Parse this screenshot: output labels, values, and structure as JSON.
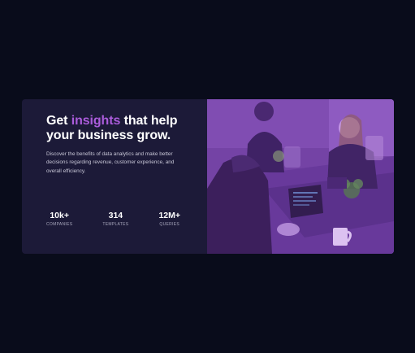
{
  "hero": {
    "headline_pre": "Get ",
    "headline_accent": "insights",
    "headline_post": " that help your business grow.",
    "description": "Discover the benefits of data analytics and make better decisions regarding revenue, customer experience, and overall efficiency."
  },
  "stats": [
    {
      "value": "10k+",
      "label": "COMPANIES"
    },
    {
      "value": "314",
      "label": "TEMPLATES"
    },
    {
      "value": "12M+",
      "label": "QUERIES"
    }
  ],
  "image": {
    "icon": "office-team-photo",
    "tint_color": "#ab5cdb"
  },
  "colors": {
    "page_background": "#090c1b",
    "card_background": "#1c1a38",
    "accent": "#ab5cdb"
  }
}
